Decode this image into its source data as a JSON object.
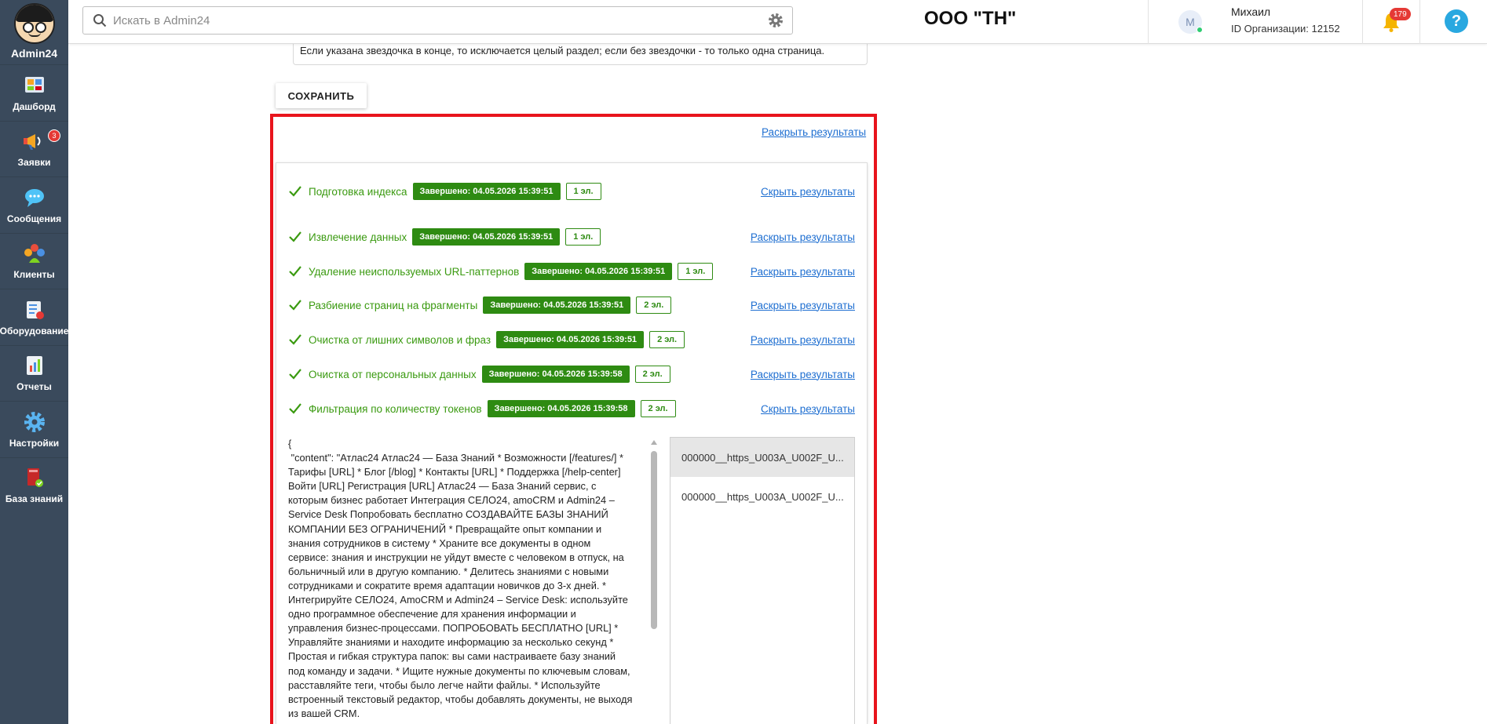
{
  "app": {
    "name": "Admin24"
  },
  "sidebar": {
    "items": [
      {
        "label": "Дашборд",
        "icon": "dashboard-icon"
      },
      {
        "label": "Заявки",
        "icon": "megaphone-icon",
        "badge": "3"
      },
      {
        "label": "Сообщения",
        "icon": "chat-icon"
      },
      {
        "label": "Клиенты",
        "icon": "clients-icon"
      },
      {
        "label": "Оборудование",
        "icon": "equipment-icon"
      },
      {
        "label": "Отчеты",
        "icon": "reports-icon"
      },
      {
        "label": "Настройки",
        "icon": "gear-icon"
      },
      {
        "label": "База знаний",
        "icon": "knowledge-book-icon"
      }
    ]
  },
  "header": {
    "search_placeholder": "Искать в Admin24",
    "org_title": "ООО \"ТН\"",
    "user": {
      "avatar_letter": "М",
      "name": "Михаил",
      "org_id": "ID Организации: 12152"
    },
    "notifications_count": "179",
    "help_label": "?"
  },
  "content": {
    "note_text": "Если указана звездочка в конце, то исключается целый раздел; если без звездочки - то только одна страница.",
    "save_label": "СОХРАНИТЬ",
    "expand_all_label": "Раскрыть результаты",
    "steps": [
      {
        "name": "Подготовка индекса",
        "status": "Завершено: 04.05.2026 15:39:51",
        "count": "1 эл.",
        "action": "Скрыть результаты"
      },
      {
        "name": "Извлечение данных",
        "status": "Завершено: 04.05.2026 15:39:51",
        "count": "1 эл.",
        "action": "Раскрыть результаты"
      },
      {
        "name": "Удаление неиспользуемых URL-паттернов",
        "status": "Завершено: 04.05.2026 15:39:51",
        "count": "1 эл.",
        "action": "Раскрыть результаты"
      },
      {
        "name": "Разбиение страниц на фрагменты",
        "status": "Завершено: 04.05.2026 15:39:51",
        "count": "2 эл.",
        "action": "Раскрыть результаты"
      },
      {
        "name": "Очистка от лишних символов и фраз",
        "status": "Завершено: 04.05.2026 15:39:51",
        "count": "2 эл.",
        "action": "Раскрыть результаты"
      },
      {
        "name": "Очистка от персональных данных",
        "status": "Завершено: 04.05.2026 15:39:58",
        "count": "2 эл.",
        "action": "Раскрыть результаты"
      },
      {
        "name": "Фильтрация по количеству токенов",
        "status": "Завершено: 04.05.2026 15:39:58",
        "count": "2 эл.",
        "action": "Скрыть результаты"
      }
    ],
    "result_json": "{\n \"content\": \"Атлас24 Атлас24 — База Знаний * Возможности [/features/] * Тарифы [URL] * Блог [/blog] * Контакты [URL] * Поддержка [/help-center] Войти [URL] Регистрация [URL] Атлас24 — База Знаний сервис, с которым бизнес работает Интеграция СЕЛО24, amoCRM и Admin24 – Service Desk Попробовать бесплатно СОЗДАВАЙТЕ БАЗЫ ЗНАНИЙ КОМПАНИИ БЕЗ ОГРАНИЧЕНИЙ * Превращайте опыт компании и знания сотрудников в систему * Храните все документы в одном сервисе: знания и инструкции не уйдут вместе с человеком в отпуск, на больничный или в другую компанию. * Делитесь знаниями с новыми сотрудниками и сократите время адаптации новичков до 3-х дней. * Интегрируйте СЕЛО24, AmoCRM и Admin24 – Service Desk: используйте одно программное обеспечение для хранения информации и управления бизнес-процессами. ПОПРОБОВАТЬ БЕСПЛАТНО [URL] * Управляйте знаниями и находите информацию за несколько секунд * Простая и гибкая структура папок: вы сами настраиваете базу знаний под команду и задачи. * Ищите нужные документы по ключевым словам, расставляйте теги, чтобы было легче найти файлы. * Используйте встроенный текстовый редактор, чтобы добавлять документы, не выходя из вашей CRM.",
    "files": [
      {
        "name": "000000__https_U003A_U002F_U..."
      },
      {
        "name": "000000__https_U003A_U002F_U..."
      }
    ]
  },
  "colors": {
    "sidebar_bg": "#3a4a5c",
    "success_green": "#2e8b12",
    "link_blue": "#1f6fd1",
    "highlight_red": "#e8141c"
  }
}
